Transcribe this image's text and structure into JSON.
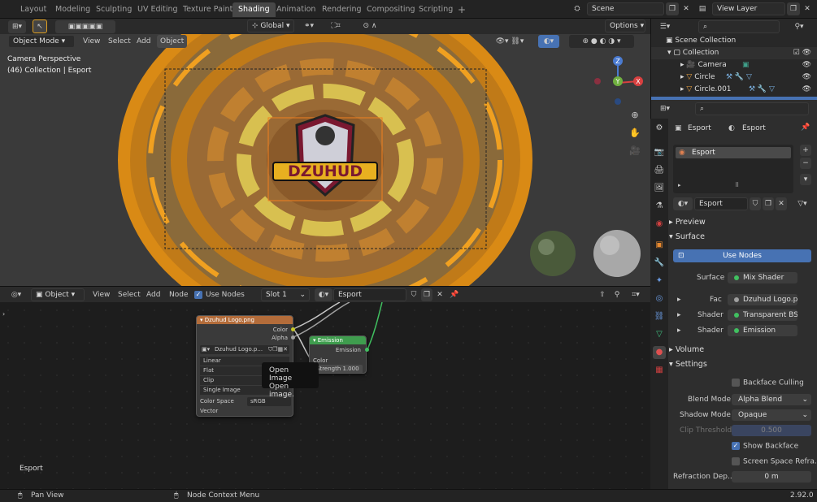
{
  "topbar": {
    "workspaces": [
      "Layout",
      "Modeling",
      "Sculpting",
      "UV Editing",
      "Texture Paint",
      "Shading",
      "Animation",
      "Rendering",
      "Compositing",
      "Scripting"
    ],
    "active_workspace": "Shading",
    "add_tab": "+",
    "scene": "Scene",
    "view_layer": "View Layer"
  },
  "viewport_header": {
    "mode": "Object Mode",
    "menus": [
      "View",
      "Select",
      "Add",
      "Object"
    ],
    "orientation": "Global",
    "options": "Options"
  },
  "viewport": {
    "camera_label": "Camera Perspective",
    "collection_label": "(46) Collection | Esport",
    "logo_text": "DZUHUD",
    "gizmo_axes": [
      "Z",
      "Y",
      "X"
    ]
  },
  "outliner": {
    "root": "Scene Collection",
    "items": [
      {
        "label": "Collection",
        "level": 1
      },
      {
        "label": "Camera",
        "level": 2
      },
      {
        "label": "Circle",
        "level": 2
      },
      {
        "label": "Circle.001",
        "level": 2
      }
    ]
  },
  "properties": {
    "object_name": "Esport",
    "material_name": "Esport",
    "slot_name": "Esport",
    "material_field": "Esport",
    "sections": {
      "preview": "Preview",
      "surface": "Surface",
      "volume": "Volume",
      "settings": "Settings"
    },
    "use_nodes": "Use Nodes",
    "surface_label": "Surface",
    "surface_value": "Mix Shader",
    "fac_label": "Fac",
    "fac_value": "Dzuhud Logo.png",
    "shader1_label": "Shader",
    "shader1_value": "Transparent BSDF",
    "shader2_label": "Shader",
    "shader2_value": "Emission",
    "backface_culling": "Backface Culling",
    "blend_mode_label": "Blend Mode",
    "blend_mode_value": "Alpha Blend",
    "shadow_mode_label": "Shadow Mode",
    "shadow_mode_value": "Opaque",
    "clip_threshold_label": "Clip Threshold",
    "clip_threshold_value": "0.500",
    "show_backface": "Show Backface",
    "screen_space": "Screen Space Refra...",
    "refraction_label": "Refraction Dep...",
    "refraction_value": "0 m"
  },
  "node_header": {
    "type": "Object",
    "menus": [
      "View",
      "Select",
      "Add",
      "Node"
    ],
    "use_nodes": "Use Nodes",
    "slot": "Slot 1",
    "material": "Esport"
  },
  "nodes": {
    "image": {
      "title": "Dzuhud Logo.png",
      "out_color": "Color",
      "out_alpha": "Alpha",
      "image_field": "Dzuhud Logo.p...",
      "interpolation": "Linear",
      "projection": "Flat",
      "extension": "Clip",
      "source": "Single Image",
      "color_space_label": "Color Space",
      "color_space_value": "sRGB",
      "vector": "Vector"
    },
    "emission": {
      "title": "Emission",
      "output": "Emission",
      "in_color": "Color",
      "strength": "Strength 1.000"
    },
    "tooltip": {
      "title": "Open Image",
      "desc": "Open image."
    },
    "material_label": "Esport"
  },
  "status": {
    "left": "Pan View",
    "middle": "Node Context Menu",
    "version": "2.92.0"
  },
  "colors": {
    "accent": "#4772b3",
    "orange": "#f0a020",
    "node_header_image": "#b36c3a",
    "node_header_emission": "#3f9d4e"
  }
}
